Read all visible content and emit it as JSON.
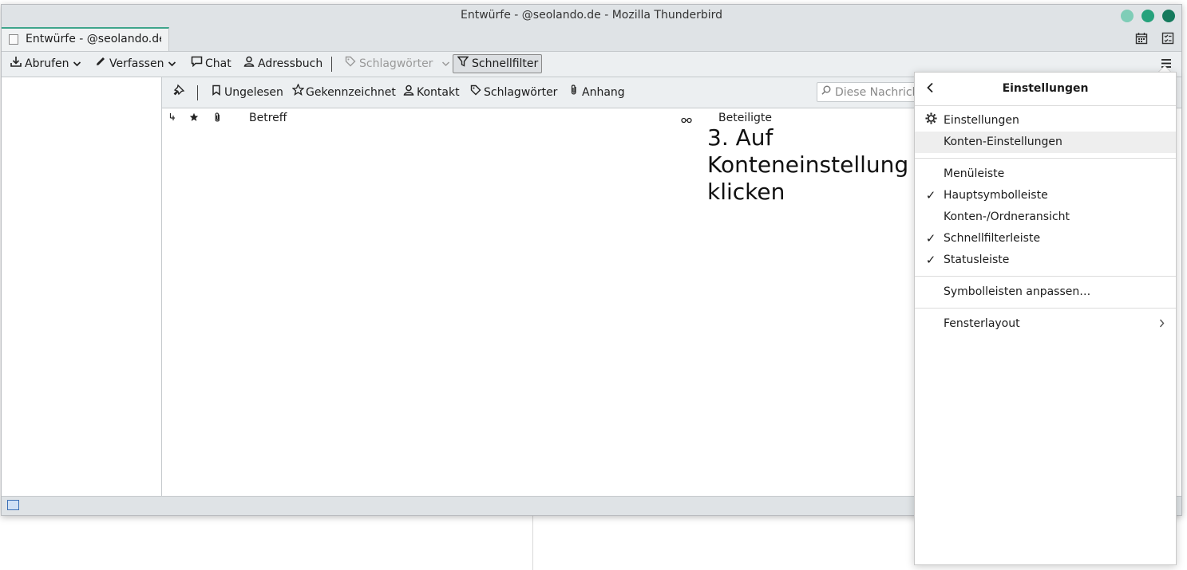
{
  "window": {
    "title": "Entwürfe -       @seolando.de - Mozilla Thunderbird",
    "controls": [
      "minimize",
      "maximize",
      "close"
    ],
    "control_colors": [
      "#7fcdb7",
      "#26a27c",
      "#157a5d"
    ]
  },
  "tab": {
    "label": "Entwürfe -       @seolando.de",
    "icon": "drafts-icon"
  },
  "toolbar": {
    "get_label": "Abrufen",
    "compose_label": "Verfassen",
    "chat_label": "Chat",
    "addressbook_label": "Adressbuch",
    "tags_label": "Schlagwörter",
    "quickfilter_label": "Schnellfilter"
  },
  "quickfilter": {
    "unread_label": "Ungelesen",
    "starred_label": "Gekennzeichnet",
    "contact_label": "Kontakt",
    "tags_label": "Schlagwörter",
    "attachment_label": "Anhang",
    "search_placeholder": "Diese Nachrichten filtern"
  },
  "thread_columns": {
    "thread_icon": "thread-icon",
    "star_icon": "star-icon",
    "attachment_icon": "attachment-icon",
    "subject": "Betreff",
    "correspondents_icon": "correspondents-icon",
    "correspondents": "Beteiligte"
  },
  "annotation": {
    "line1": "3. Auf",
    "line2": "Konteneinstellung",
    "line3": "klicken"
  },
  "panel": {
    "title": "Einstellungen",
    "items": [
      {
        "label": "Einstellungen",
        "icon": "gear-icon"
      },
      {
        "label": "Konten-Einstellungen",
        "highlighted": true
      },
      {
        "label": "Menüleiste",
        "checked": false
      },
      {
        "label": "Hauptsymbolleiste",
        "checked": true
      },
      {
        "label": "Konten-/Ordneransicht",
        "checked": false
      },
      {
        "label": "Schnellfilterleiste",
        "checked": true
      },
      {
        "label": "Statusleiste",
        "checked": true
      },
      {
        "label": "Symbolleisten anpassen…"
      },
      {
        "label": "Fensterlayout",
        "submenu": true
      }
    ]
  },
  "colors": {
    "accent": "#3fa58c",
    "chrome": "#dfe3e6",
    "toolbar": "#eceff1"
  }
}
